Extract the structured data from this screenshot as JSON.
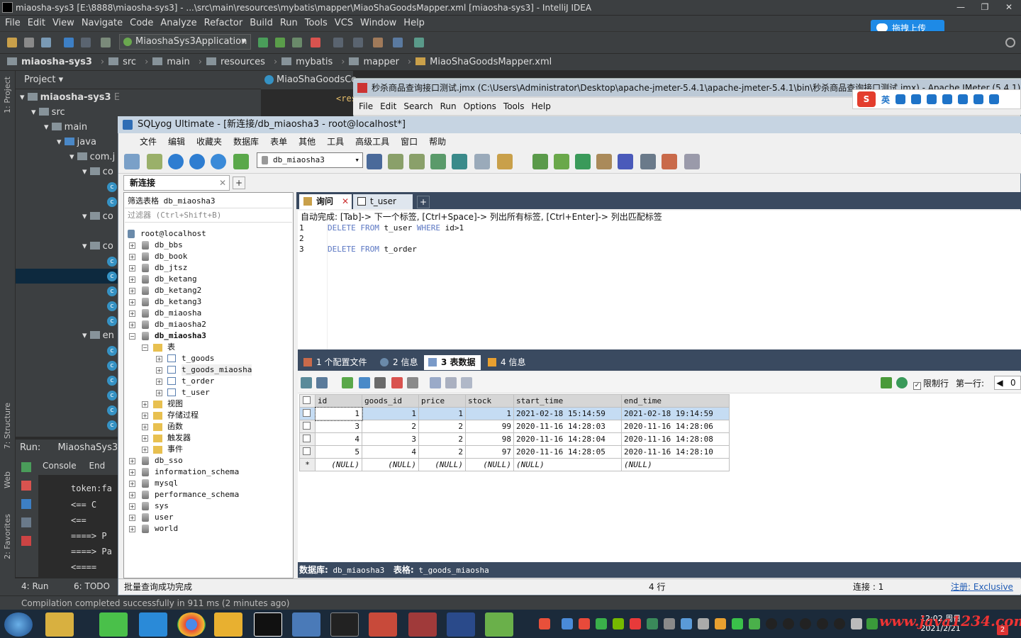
{
  "ide": {
    "title": "miaosha-sys3 [E:\\8888\\miaosha-sys3] - ...\\src\\main\\resources\\mybatis\\mapper\\MiaoShaGoodsMapper.xml [miaosha-sys3] - IntelliJ IDEA",
    "menu": [
      "File",
      "Edit",
      "View",
      "Navigate",
      "Code",
      "Analyze",
      "Refactor",
      "Build",
      "Run",
      "Tools",
      "VCS",
      "Window",
      "Help"
    ],
    "run_config": "MiaoshaSys3Application",
    "upload_button": "拖拽上传",
    "breadcrumb": [
      "miaosha-sys3",
      "src",
      "main",
      "resources",
      "mybatis",
      "mapper",
      "MiaoShaGoodsMapper.xml"
    ],
    "project_header": "Project",
    "tree": {
      "root": "miaosha-sys3",
      "root_path": "E:\\8888\\miaosha-sys3",
      "src": "src",
      "main": "main",
      "java": "java",
      "com": "com.j",
      "co": "co",
      "en": "en"
    },
    "editor_tab": "MiaoShaGoodsCo",
    "editor_snippet": "<res",
    "run_label": "Run:",
    "run_app": "MiaoshaSys3",
    "console_tab": "Console",
    "endpoints_tab": "End",
    "console_lines": [
      "token:fa",
      "<==      C",
      "<==",
      "====>   P",
      "====>  Pa",
      "<===="
    ],
    "bottom_tabs": [
      "4: Run",
      "6: TODO"
    ],
    "status": "Compilation completed successfully in 911 ms (2 minutes ago)",
    "side_labels": [
      "1: Project",
      "7: Structure",
      "Web",
      "2: Favorites"
    ]
  },
  "jmeter": {
    "title": "秒杀商品查询接口测试.jmx (C:\\Users\\Administrator\\Desktop\\apache-jmeter-5.4.1\\apache-jmeter-5.4.1\\bin\\秒杀商品查询接口测试.jmx) - Apache JMeter (5.4.1)",
    "menu": [
      "File",
      "Edit",
      "Search",
      "Run",
      "Options",
      "Tools",
      "Help"
    ],
    "ime_label": "英"
  },
  "sqlyog": {
    "title": "SQLyog Ultimate - [新连接/db_miaosha3 - root@localhost*]",
    "menu": [
      "文件",
      "编辑",
      "收藏夹",
      "数据库",
      "表单",
      "其他",
      "工具",
      "高级工具",
      "窗口",
      "帮助"
    ],
    "db_selector": "db_miaosha3",
    "connection_tab": "新连接",
    "filter_label": "筛选表格",
    "filter_value": "db_miaosha3",
    "filter_placeholder": "过滤器 (Ctrl+Shift+B)",
    "server": "root@localhost",
    "databases_before": [
      "db_bbs",
      "db_book",
      "db_jtsz",
      "db_ketang",
      "db_ketang2",
      "db_ketang3",
      "db_miaosha",
      "db_miaosha2"
    ],
    "active_db": "db_miaosha3",
    "tables_folder": "表",
    "tables": [
      "t_goods",
      "t_goods_miaosha",
      "t_order",
      "t_user"
    ],
    "other_folders": [
      "视图",
      "存储过程",
      "函数",
      "触发器",
      "事件"
    ],
    "databases_after": [
      "db_sso",
      "information_schema",
      "mysql",
      "performance_schema",
      "sys",
      "user",
      "world"
    ],
    "query_tabs": [
      "询问",
      "t_user"
    ],
    "autocomplete_hint": "自动完成: [Tab]-> 下一个标签, [Ctrl+Space]-> 列出所有标签, [Ctrl+Enter]-> 列出匹配标签",
    "line_numbers": [
      "1",
      "2",
      "3"
    ],
    "sql1": {
      "kw1": "DELETE",
      "kw2": "FROM",
      "table": "t_user",
      "kw3": "WHERE",
      "cond": "id>1"
    },
    "sql3": {
      "kw1": "DELETE",
      "kw2": "FROM",
      "table": "t_order"
    },
    "result_tabs": [
      "1 个配置文件",
      "2 信息",
      "3 表数据",
      "4 信息"
    ],
    "limit_label": "限制行",
    "first_row_label": "第一行:",
    "first_row_value": "0",
    "grid": {
      "columns": [
        "id",
        "goods_id",
        "price",
        "stock",
        "start_time",
        "end_time"
      ],
      "rows": [
        [
          "1",
          "1",
          "1",
          "1",
          "2021-02-18 15:14:59",
          "2021-02-18 19:14:59"
        ],
        [
          "3",
          "2",
          "2",
          "99",
          "2020-11-16 14:28:03",
          "2020-11-16 14:28:06"
        ],
        [
          "4",
          "3",
          "2",
          "98",
          "2020-11-16 14:28:04",
          "2020-11-16 14:28:08"
        ],
        [
          "5",
          "4",
          "2",
          "97",
          "2020-11-16 14:28:05",
          "2020-11-16 14:28:10"
        ]
      ],
      "new_row_marker": "*",
      "null_text": "(NULL)"
    },
    "db_status_label": "数据库:",
    "db_status_value": "db_miaosha3",
    "table_status_label": "表格:",
    "table_status_value": "t_goods_miaosha",
    "status_message": "批量查询成功完成",
    "status_rows": "4 行",
    "status_conn": "连接 : 1",
    "status_reg": "注册:  Exclusive"
  },
  "taskbar": {
    "watermark": "www.java1234.com",
    "clock_date": "2021/2/21",
    "clock_time": "12:02 周日"
  },
  "colors": {
    "ide_bg": "#3c3f41",
    "sqlyog_header": "#3a4a60",
    "selected_row": "#c5dcf3",
    "keyword": "#5b77c3",
    "upload_button": "#1e8ae6"
  }
}
